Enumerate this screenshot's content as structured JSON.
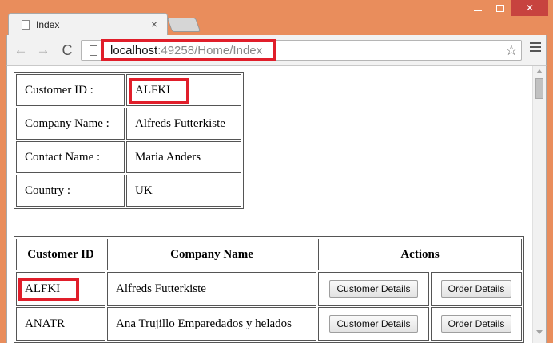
{
  "window": {
    "minimize_label": "",
    "maximize_label": "",
    "close_label": "✕"
  },
  "tab": {
    "title": "Index",
    "close": "×"
  },
  "toolbar": {
    "url_host": "localhost",
    "url_rest": ":49258/Home/Index",
    "back_glyph": "←",
    "forward_glyph": "→",
    "reload_glyph": "C",
    "star_glyph": "☆"
  },
  "detail": {
    "rows": [
      {
        "label": "Customer ID :",
        "value": "ALFKI"
      },
      {
        "label": "Company Name :",
        "value": "Alfreds Futterkiste"
      },
      {
        "label": "Contact Name :",
        "value": "Maria Anders"
      },
      {
        "label": "Country :",
        "value": "UK"
      }
    ]
  },
  "customers": {
    "headers": [
      "Customer ID",
      "Company Name",
      "Actions"
    ],
    "rows": [
      {
        "id": "ALFKI",
        "name": "Alfreds Futterkiste",
        "details_btn": "Customer Details",
        "orders_btn": "Order Details"
      },
      {
        "id": "ANATR",
        "name": "Ana Trujillo Emparedados y helados",
        "details_btn": "Customer Details",
        "orders_btn": "Order Details"
      }
    ]
  },
  "colors": {
    "frame": "#e98d5c",
    "highlight": "#e01e2a",
    "close_button": "#c7433f"
  }
}
